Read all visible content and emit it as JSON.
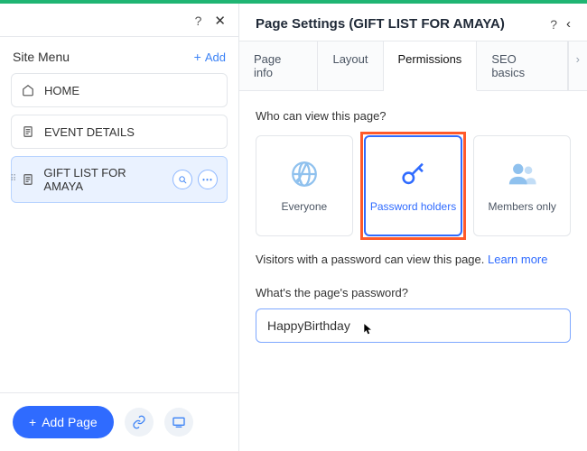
{
  "sidebar": {
    "title": "Site Menu",
    "add_label": "Add",
    "items": [
      {
        "label": "HOME",
        "icon": "home-icon",
        "selected": false
      },
      {
        "label": "EVENT DETAILS",
        "icon": "page-icon",
        "selected": false
      },
      {
        "label": "GIFT LIST FOR AMAYA",
        "icon": "page-icon",
        "selected": true
      }
    ],
    "add_page_label": "Add Page"
  },
  "panel": {
    "title": "Page Settings (GIFT LIST FOR AMAYA)",
    "tabs": [
      {
        "label": "Page info",
        "active": false
      },
      {
        "label": "Layout",
        "active": false
      },
      {
        "label": "Permissions",
        "active": true
      },
      {
        "label": "SEO basics",
        "active": false
      }
    ],
    "question": "Who can view this page?",
    "options": [
      {
        "label": "Everyone",
        "icon": "globe-icon",
        "selected": false
      },
      {
        "label": "Password holders",
        "icon": "key-icon",
        "selected": true,
        "highlighted": true
      },
      {
        "label": "Members only",
        "icon": "members-icon",
        "selected": false
      }
    ],
    "helper_text": "Visitors with a password can view this page. ",
    "learn_more": "Learn more",
    "password_label": "What's the page's password?",
    "password_value": "HappyBirthday"
  }
}
